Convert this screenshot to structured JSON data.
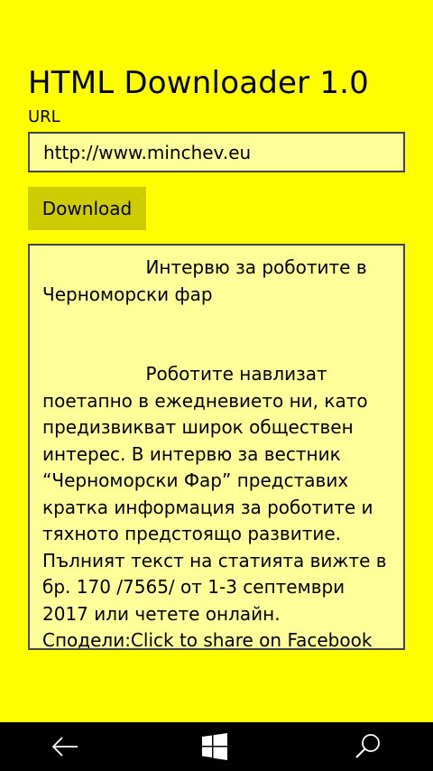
{
  "app": {
    "title": "HTML Downloader 1.0"
  },
  "url_field": {
    "label": "URL",
    "value": "http://www.minchev.eu"
  },
  "download_button": {
    "label": "Download"
  },
  "content": {
    "text": "                  Интервю за роботите в Черноморски фар\n\n\n                  Роботите навлизат поетапно в ежедневието ни, като предизвикват широк обществен интерес. В интервю за вестник “Черноморски Фар” представих кратка информация за роботите и тяхното предстоящо развитие. Пълният текст на статията вижте в бр. 170 /7565/ от 1-3 септември 2017 или четете онлайн.\nСподели:Click to share on Facebook"
  },
  "nav_bar": {
    "buttons": [
      {
        "name": "back",
        "icon": "back-arrow-icon"
      },
      {
        "name": "start",
        "icon": "windows-logo-icon"
      },
      {
        "name": "search",
        "icon": "search-icon"
      }
    ]
  },
  "colors": {
    "background": "#ffff00",
    "field_background": "#ffff99",
    "button_background": "#cccc00",
    "border": "#444444",
    "nav_background": "#000000",
    "nav_icon": "#ffffff"
  }
}
